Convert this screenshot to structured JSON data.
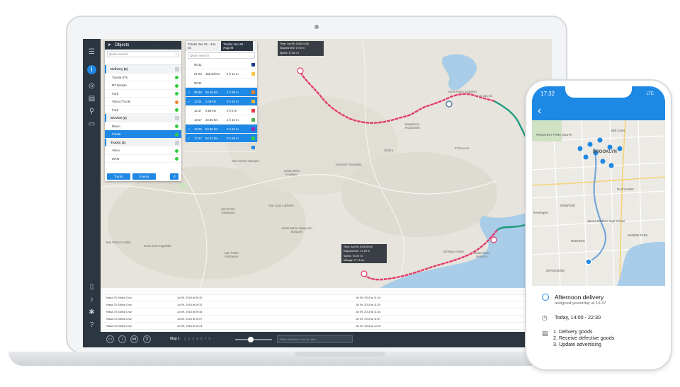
{
  "objects_panel": {
    "title": "Objects",
    "search_placeholder": "Quick Search",
    "groups": [
      {
        "label": "Delivery (5)",
        "items": [
          {
            "label": "Toyota 575",
            "status": "#2ecc40"
          },
          {
            "label": "RT Nissan",
            "status": "#2ecc40"
          },
          {
            "label": "Ford",
            "status": "#2ecc40"
          },
          {
            "label": "Volvo (Truck)",
            "status": "#f07f2a"
          },
          {
            "label": "Ford",
            "status": "#2ecc40"
          }
        ]
      },
      {
        "label": "Service (2)",
        "items": [
          {
            "label": "Bravo",
            "status": "#2ecc40"
          },
          {
            "label": "Fiesta",
            "status": "#2ecc40",
            "selected": true
          }
        ]
      },
      {
        "label": "Trucks (2)",
        "items": [
          {
            "label": "Volvo",
            "status": "#2ecc40"
          },
          {
            "label": "MAN",
            "status": "#2ecc40"
          }
        ]
      }
    ],
    "tracks_button": "Tracks",
    "events_button": "Events"
  },
  "tracks_panel": {
    "tab1": "Tracks Jun 01 - Jun 02",
    "tab2": "Tracks Jun 20 - Aug 08",
    "search_placeholder": "Quick Search",
    "rows": [
      {
        "time": "06:31",
        "dist": "",
        "dur": "",
        "color": "#1e3a8a",
        "selected": false
      },
      {
        "time": "07:24",
        "dist": "165.83 km",
        "dur": "2 h 12 m",
        "color": "#f4c542",
        "selected": false
      },
      {
        "time": "08:31",
        "dist": "",
        "dur": "",
        "color": "",
        "selected": false
      },
      {
        "time": "09:38",
        "dist": "94.26 km",
        "dur": "1 h 38 m",
        "color": "#f07f2a",
        "selected": true
      },
      {
        "time": "12:01",
        "dist": "3.49 km",
        "dur": "0 h 15 m",
        "color": "#e8b23b",
        "selected": true
      },
      {
        "time": "13:17",
        "dist": "0.56 km",
        "dur": "0 h 5 m",
        "color": "#e63946",
        "selected": false
      },
      {
        "time": "13:17",
        "dist": "44.85 km",
        "dur": "1 h 10 m",
        "color": "#4caf50",
        "selected": false
      },
      {
        "time": "15:29",
        "dist": "54.80 km",
        "dur": "0 h 54 m",
        "color": "#9c27b0",
        "selected": true
      },
      {
        "time": "17:47",
        "dist": "54.31 km",
        "dur": "0 h 58 m",
        "color": "#2ecc40",
        "selected": true
      },
      {
        "time": "",
        "dist": "",
        "dur": "",
        "color": "#1e88e5",
        "selected": false
      }
    ]
  },
  "tooltip_top": {
    "line1": "Time: Jun 09, 2018 10:28",
    "line2": "Elapsed time: 0 h 0 m",
    "line3": "Speed: 17 km / h"
  },
  "tooltip_bottom": {
    "line1": "Time: Jun 09, 2018 09:30",
    "line2": "Elapsed time: 1 h 29 m",
    "line3": "Speed: 72 km / h",
    "line4": "Mileage: 77.71 km"
  },
  "map_places": [
    "Santa Maria Zoquitlán",
    "El Jazmín",
    "Magdalena Tequisistlán",
    "Zimbra",
    "El Porvenir",
    "Asunción Tlacolulita",
    "Santa María Ecatepec",
    "San Carlos Yautepec",
    "San Juan Lachixila",
    "San Pedro Totolapam",
    "Santa María Jalapa del Marqués",
    "San Pedro Huilotepec",
    "Santa Cruz Tagolaba",
    "San Pablo Coatlán",
    "Santiago Astata",
    "Santa María Huatulco"
  ],
  "selected_tracks": "Selected 4 tracks",
  "table_rows": [
    {
      "name": "Nissa-70-Salina Cruz",
      "date": "Jul 09, 2018 at 09:30",
      "addr": "Jul 09, 2018 at 11:18"
    },
    {
      "name": "Nissa-70-Salina Cruz",
      "date": "Jul 09, 2018 at 09:32",
      "addr": "Jul 09, 2018 at 11:20"
    },
    {
      "name": "Nissa-70-Salina Cruz",
      "date": "Jul 09, 2018 at 09:48",
      "addr": "Jul 09, 2018 at 11:44"
    },
    {
      "name": "Nissa-70-Salina Cruz",
      "date": "Jul 09, 2018 at 10:07",
      "addr": "Jul 09, 2018 at 11:57"
    },
    {
      "name": "Nissa-70-Salina Cruz",
      "date": "Jul 09, 2018 at 10:24",
      "addr": "Jul 09, 2018 at 12:10"
    }
  ],
  "bottom_bar": {
    "map_label": "Map 1",
    "pages": "2 3 4 5 6 7 8",
    "address_placeholder": "Enter address or lat, lon pair..."
  },
  "phone": {
    "clock": "17:32",
    "signal": "LTE",
    "map_labels": [
      "PROSPECT PARK SOUTH",
      "BROOKLYN",
      "FLATLANDS",
      "MIDWOOD",
      "GRAVESEND",
      "MADISON",
      "MARINE PARK",
      "Kensington",
      "James Madison High School",
      "Belt Cross"
    ],
    "card_title": "Afternoon delivery",
    "card_sub": "assigned yesterday at 16:47",
    "card_time": "Today, 14:00 - 22:30",
    "card_items": [
      "1. Delivery goods",
      "2. Receive defective goods",
      "3. Update advertising"
    ]
  },
  "colors": {
    "accent": "#1e88e5",
    "track_pink": "#e13b6b",
    "track_teal": "#1d9a7e",
    "sidebar": "#2b3641"
  }
}
